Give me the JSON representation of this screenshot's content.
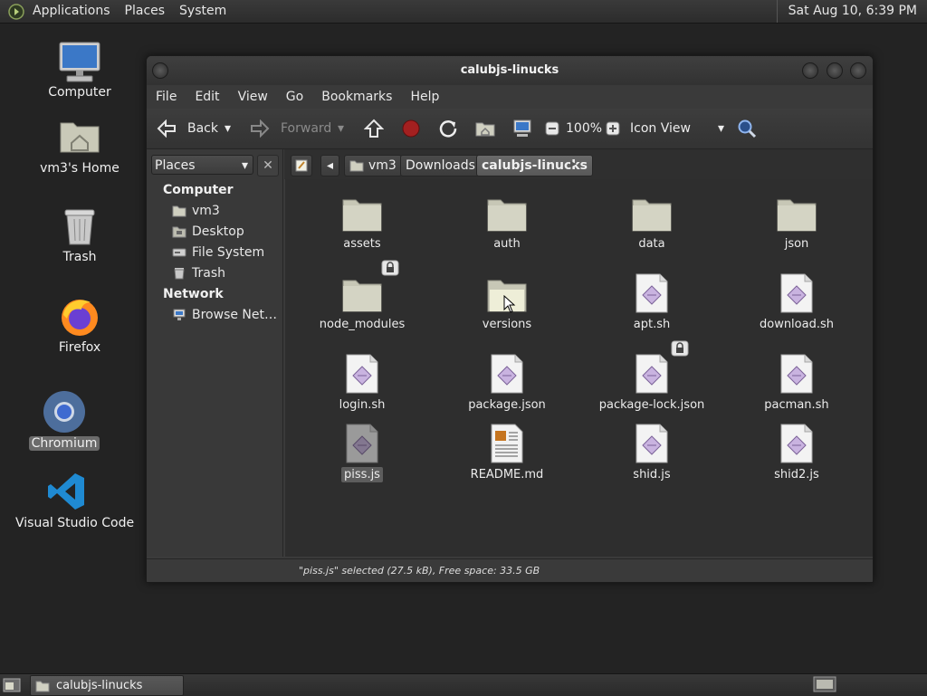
{
  "top_panel": {
    "menus": [
      "Applications",
      "Places",
      "System"
    ],
    "clock": "Sat Aug 10,  6:39 PM"
  },
  "desktop": {
    "icons": [
      {
        "label": "Computer"
      },
      {
        "label": "vm3's Home"
      },
      {
        "label": "Trash"
      },
      {
        "label": "Firefox"
      },
      {
        "label": "Chromium",
        "selected": true
      },
      {
        "label": "Visual Studio Code"
      }
    ]
  },
  "window": {
    "title": "calubjs-linucks",
    "menu": [
      "File",
      "Edit",
      "View",
      "Go",
      "Bookmarks",
      "Help"
    ],
    "toolbar": {
      "back": "Back",
      "forward": "Forward",
      "zoom": "100%",
      "view_mode": "Icon View"
    },
    "sidebar": {
      "combo": "Places",
      "close_symbol": "✕",
      "sections": [
        {
          "heading": "Computer",
          "items": [
            "vm3",
            "Desktop",
            "File System",
            "Trash"
          ]
        },
        {
          "heading": "Network",
          "items": [
            "Browse Net…"
          ]
        }
      ]
    },
    "path": [
      "vm3",
      "Downloads",
      "calubjs-linucks"
    ],
    "files": [
      {
        "name": "assets",
        "type": "folder"
      },
      {
        "name": "auth",
        "type": "folder"
      },
      {
        "name": "data",
        "type": "folder"
      },
      {
        "name": "json",
        "type": "folder"
      },
      {
        "name": "node_modules",
        "type": "folder",
        "locked": true
      },
      {
        "name": "versions",
        "type": "folder-open"
      },
      {
        "name": "apt.sh",
        "type": "script"
      },
      {
        "name": "download.sh",
        "type": "script"
      },
      {
        "name": "login.sh",
        "type": "script"
      },
      {
        "name": "package.json",
        "type": "script"
      },
      {
        "name": "package-lock.json",
        "type": "script",
        "locked": true
      },
      {
        "name": "pacman.sh",
        "type": "script"
      },
      {
        "name": "piss.js",
        "type": "script",
        "selected": true
      },
      {
        "name": "README.md",
        "type": "text"
      },
      {
        "name": "shid.js",
        "type": "script"
      },
      {
        "name": "shid2.js",
        "type": "script"
      }
    ],
    "status": "\"piss.js\" selected (27.5 kB), Free space: 33.5 GB"
  },
  "taskbar": {
    "tasks": [
      "calubjs-linucks"
    ]
  }
}
